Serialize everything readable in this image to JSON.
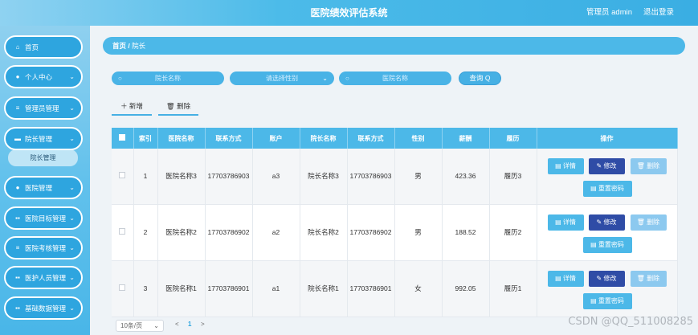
{
  "header": {
    "title": "医院绩效评估系统",
    "user": "管理员 admin",
    "logout": "退出登录"
  },
  "sidebar": {
    "items": [
      {
        "label": "首页",
        "icon": "home-icon",
        "glyph": "⌂",
        "expandable": false
      },
      {
        "label": "个人中心",
        "icon": "user-icon",
        "glyph": "●",
        "expandable": true
      },
      {
        "label": "管理员管理",
        "icon": "list-icon",
        "glyph": "≡",
        "expandable": true
      },
      {
        "label": "院长管理",
        "icon": "card-icon",
        "glyph": "▬",
        "expandable": true
      },
      {
        "label": "医院管理",
        "icon": "bulb-icon",
        "glyph": "●",
        "expandable": true
      },
      {
        "label": "医院目标管理",
        "icon": "grid-icon",
        "glyph": "▪▪",
        "expandable": true
      },
      {
        "label": "医院考核管理",
        "icon": "list-icon",
        "glyph": "≡",
        "expandable": true
      },
      {
        "label": "医护人员管理",
        "icon": "grid-icon",
        "glyph": "▪▪",
        "expandable": true
      },
      {
        "label": "基础数据管理",
        "icon": "grid-icon",
        "glyph": "▪▪",
        "expandable": true
      }
    ],
    "submenu_label": "院长管理"
  },
  "breadcrumb": {
    "home": "首页",
    "sep": "/",
    "current": "院长"
  },
  "search": {
    "hospital_placeholder": "院长名称",
    "gender_placeholder": "请选择性别",
    "name_placeholder": "医院名称",
    "query_label": "查询 Q"
  },
  "actions": {
    "add_label": "＋ 新增",
    "delete_label": "🗑 删除"
  },
  "table": {
    "headers": [
      "",
      "索引",
      "医院名称",
      "联系方式",
      "账户",
      "院长名称",
      "联系方式",
      "性别",
      "薪酬",
      "履历",
      "操作"
    ],
    "rows": [
      {
        "index": "1",
        "hospital": "医院名称3",
        "phone1": "17703786903",
        "account": "a3",
        "name": "院长名称3",
        "phone2": "17703786903",
        "gender": "男",
        "salary": "423.36",
        "resume": "履历3"
      },
      {
        "index": "2",
        "hospital": "医院名称2",
        "phone1": "17703786902",
        "account": "a2",
        "name": "院长名称2",
        "phone2": "17703786902",
        "gender": "男",
        "salary": "188.52",
        "resume": "履历2"
      },
      {
        "index": "3",
        "hospital": "医院名称1",
        "phone1": "17703786901",
        "account": "a1",
        "name": "院长名称1",
        "phone2": "17703786901",
        "gender": "女",
        "salary": "992.05",
        "resume": "履历1"
      }
    ],
    "ops": {
      "detail": "▤ 详情",
      "edit": "✎ 修改",
      "delete": "🗑 删除",
      "reset": "▤ 重置密码"
    }
  },
  "pager": {
    "size": "10条/页",
    "prev": "<",
    "page": "1",
    "next": ">"
  },
  "watermark": "CSDN @QQ_511008285"
}
